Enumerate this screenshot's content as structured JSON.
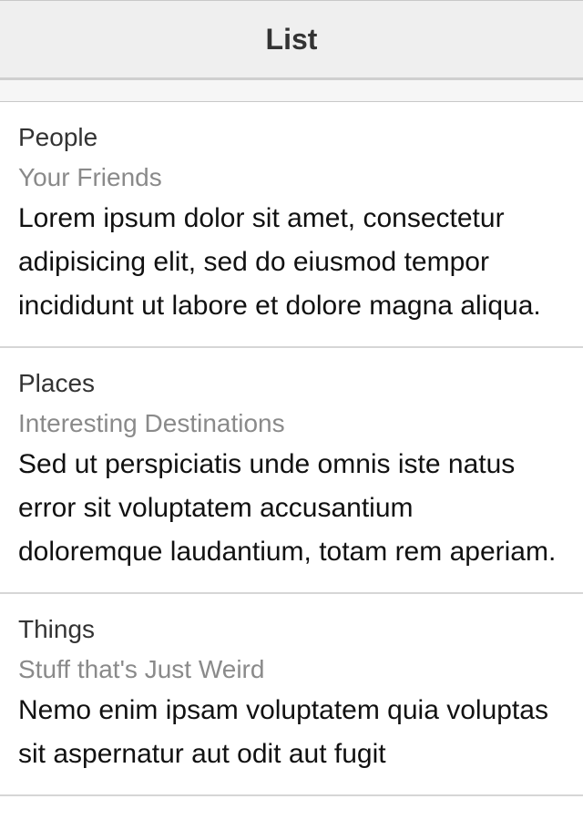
{
  "navbar": {
    "title": "List"
  },
  "items": [
    {
      "title": "People",
      "subtitle": "Your Friends",
      "body": "Lorem ipsum dolor sit amet, consectetur adipisicing elit, sed do eiusmod tempor incididunt ut labore et dolore magna aliqua."
    },
    {
      "title": "Places",
      "subtitle": "Interesting Destinations",
      "body": "Sed ut perspiciatis unde omnis iste natus error sit voluptatem accusantium doloremque laudantium, totam rem aperiam."
    },
    {
      "title": "Things",
      "subtitle": "Stuff that's Just Weird",
      "body": "Nemo enim ipsam voluptatem quia voluptas sit aspernatur aut odit aut fugit"
    }
  ]
}
